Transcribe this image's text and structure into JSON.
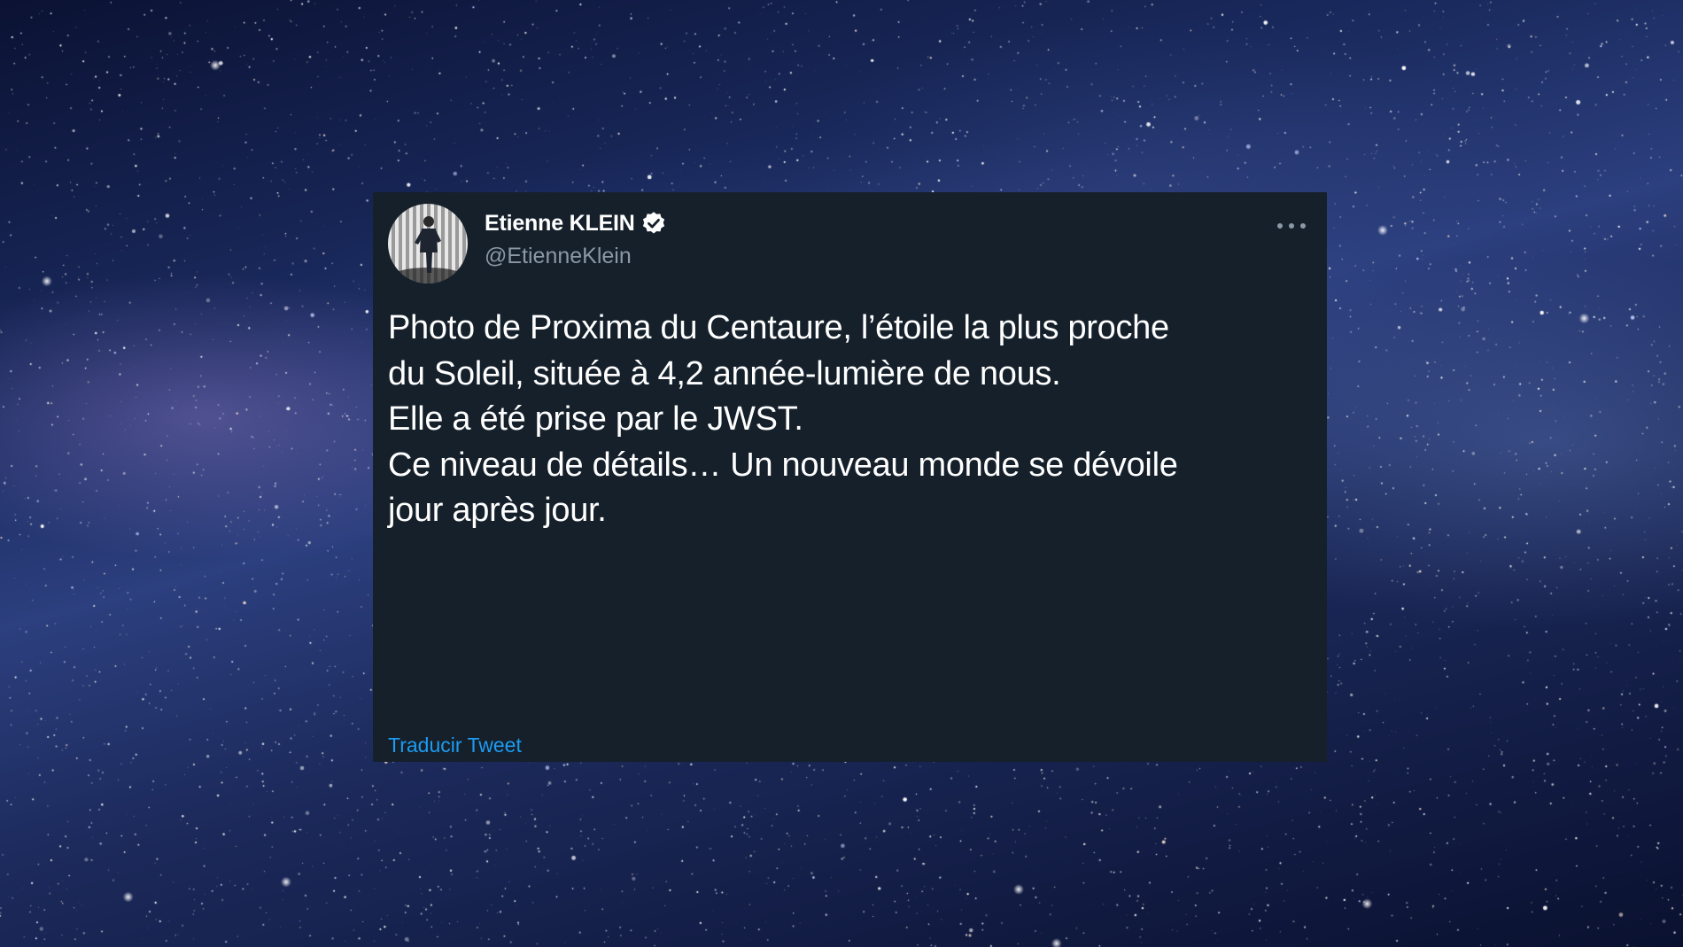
{
  "background": {
    "description_colors": {
      "deep": "#0b1233",
      "mid": "#2c3f7e",
      "glow": "#aa8cdc"
    }
  },
  "tweet": {
    "author": {
      "display_name": "Etienne KLEIN",
      "handle": "@EtienneKlein",
      "verified": true,
      "avatar_icon": "avatar-photo"
    },
    "text_lines": [
      "Photo de Proxima du Centaure, l’étoile la plus proche",
      "du Soleil, située à 4,2 année-lumière de nous.",
      "Elle a été prise par le JWST.",
      "Ce niveau de détails… Un nouveau monde se dévoile",
      "jour après jour."
    ],
    "translate_label": "Traducir Tweet",
    "more_icon": "more-horizontal-icon"
  },
  "colors": {
    "card_background": "#15202b",
    "text_primary": "#ffffff",
    "text_secondary": "#8b98a5",
    "link": "#1d9bf0",
    "verified_badge": "#ffffff"
  }
}
